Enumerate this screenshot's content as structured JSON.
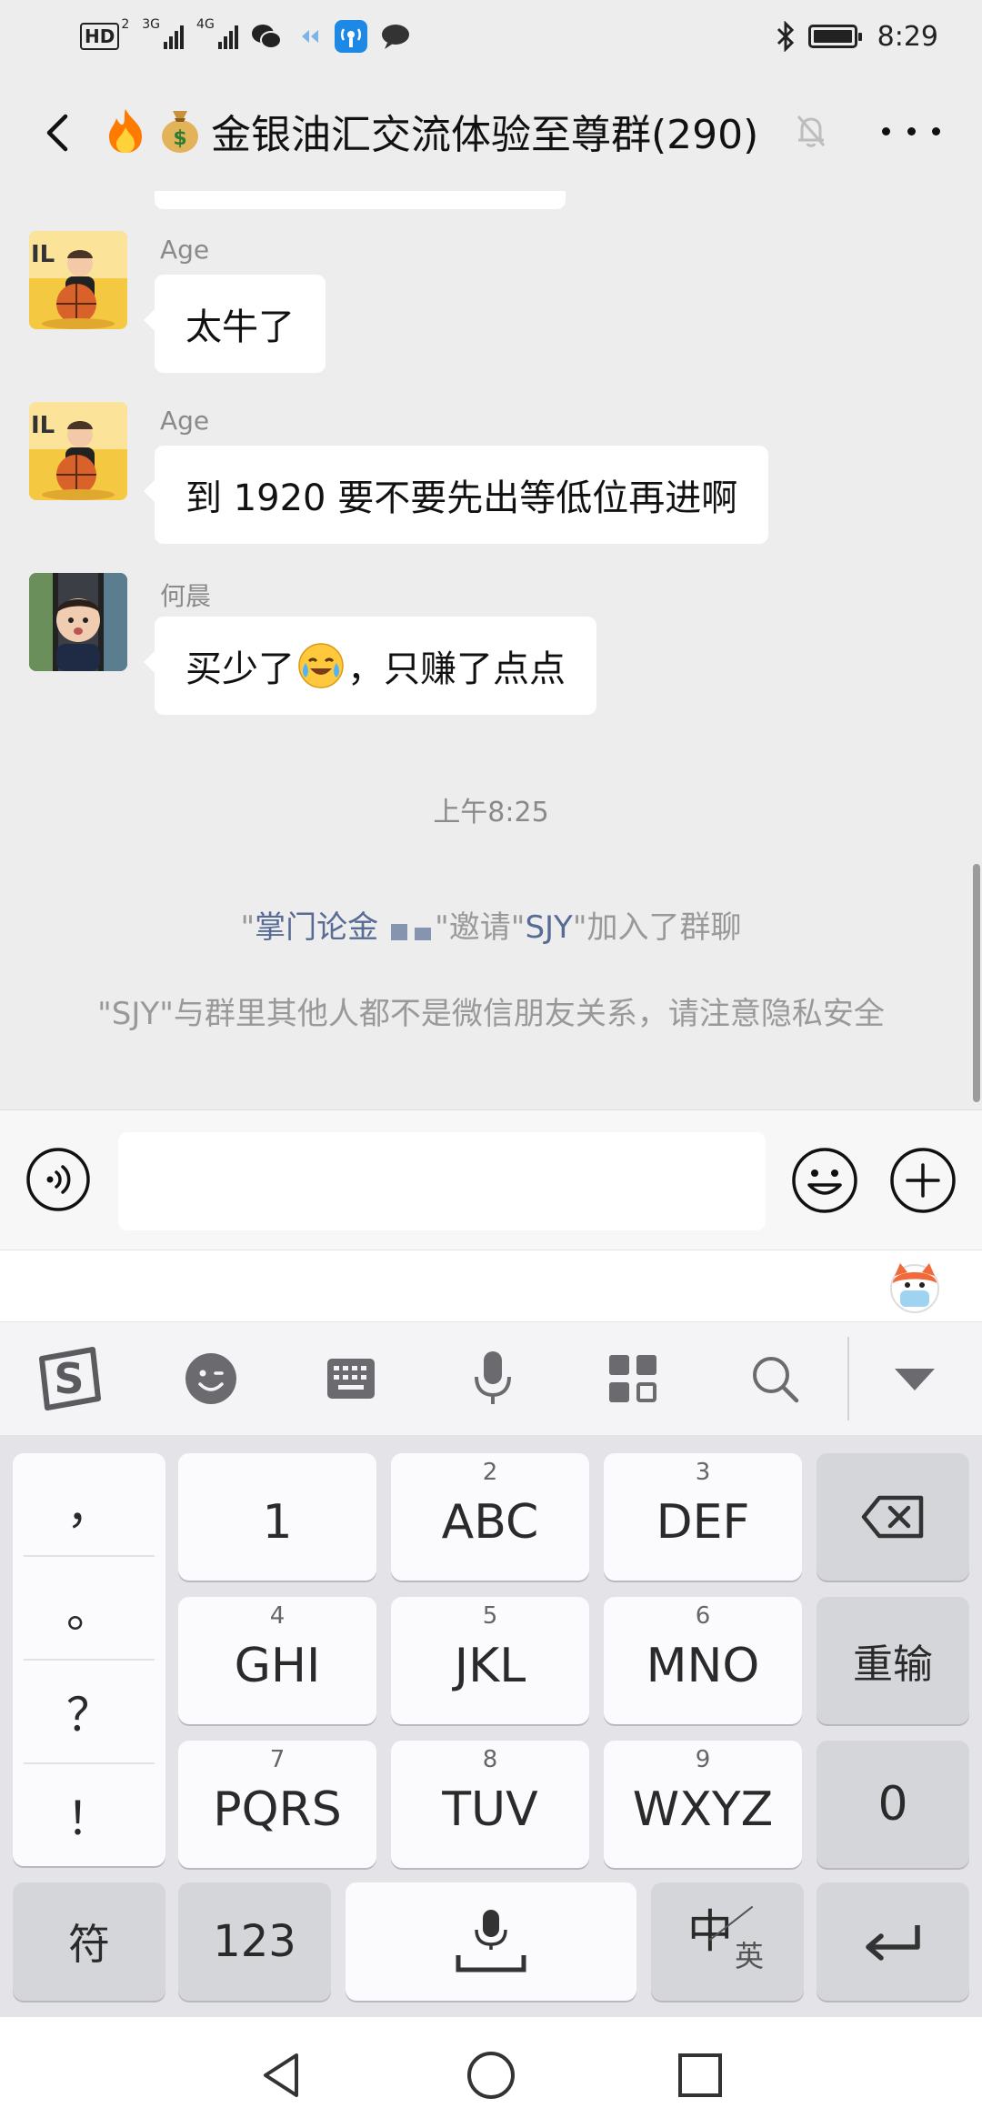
{
  "status_bar": {
    "hd_badge": "HD",
    "hd_sub": "2",
    "net1": "3G",
    "net2": "4G",
    "time": "8:29"
  },
  "header": {
    "title": "金银油汇交流体验至尊群(290)",
    "title_emojis": [
      "🔥",
      "💰"
    ]
  },
  "messages": [
    {
      "sender": "Age",
      "text": "太牛了",
      "avatar": "basketball-kid-avatar"
    },
    {
      "sender": "Age",
      "text": "到 1920 要不要先出等低位再进啊",
      "avatar": "basketball-kid-avatar"
    },
    {
      "sender": "何晨",
      "text_before": "买少了",
      "text_after": "，只赚了点点",
      "avatar": "toddler-avatar"
    }
  ],
  "timestamp": "上午8:25",
  "system_invite": {
    "q1": "\"",
    "inviter": "掌门论金",
    "q2": "\"",
    "middle": "邀请\"",
    "invitee": "SJY",
    "end": "\"加入了群聊"
  },
  "system_notice": "\"SJY\"与群里其他人都不是微信朋友关系，请注意隐私安全",
  "keyboard": {
    "punctuation": [
      "，",
      "。",
      "？",
      "！"
    ],
    "keys": [
      {
        "num": "",
        "label": "1"
      },
      {
        "num": "2",
        "label": "ABC"
      },
      {
        "num": "3",
        "label": "DEF"
      },
      {
        "num": "4",
        "label": "GHI"
      },
      {
        "num": "5",
        "label": "JKL"
      },
      {
        "num": "6",
        "label": "MNO"
      },
      {
        "num": "7",
        "label": "PQRS"
      },
      {
        "num": "8",
        "label": "TUV"
      },
      {
        "num": "9",
        "label": "WXYZ"
      }
    ],
    "reinput": "重输",
    "zero": "0",
    "symbols": "符",
    "numbers": "123",
    "lang_main": "中",
    "lang_alt": "英"
  },
  "colors": {
    "background": "#ededed",
    "link": "#576b95",
    "system_text": "#999999",
    "bubble": "#ffffff"
  }
}
